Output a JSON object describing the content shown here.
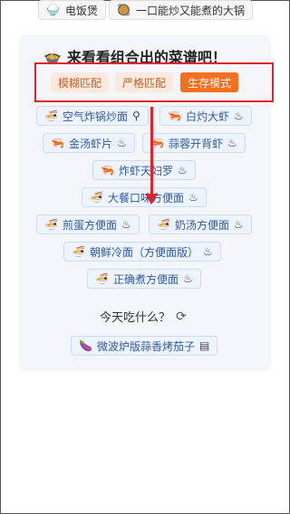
{
  "top_chips": [
    {
      "icon": "🍚",
      "label": "电饭煲"
    },
    {
      "icon": "🥘",
      "label": "一口能炒又能煮的大锅"
    }
  ],
  "header": {
    "icon": "🍲",
    "title": "来看看组合出的菜谱吧！"
  },
  "modes": {
    "fuzzy": "模糊匹配",
    "strict": "严格匹配",
    "survival": "生存模式"
  },
  "recipes": [
    {
      "icon": "🍜",
      "label": "空气炸锅炒面",
      "trail": "⚲"
    },
    {
      "icon": "🦐",
      "label": "白灼大虾",
      "trail": "♨"
    },
    {
      "icon": "🦐",
      "label": "金汤虾片",
      "trail": "♨"
    },
    {
      "icon": "🦐",
      "label": "蒜蓉开背虾",
      "trail": "♨"
    },
    {
      "icon": "🦐",
      "label": "炸虾天妇罗",
      "trail": "♨"
    },
    {
      "icon": "🍜",
      "label": "大餐口味方便面",
      "trail": "♨"
    },
    {
      "icon": "🍜",
      "label": "煎蛋方便面",
      "trail": "♨"
    },
    {
      "icon": "🍜",
      "label": "奶汤方便面",
      "trail": "♨"
    },
    {
      "icon": "🍜",
      "label": "朝鲜冷面（方便面版）",
      "trail": "♨"
    },
    {
      "icon": "🍜",
      "label": "正确煮方便面",
      "trail": "♨"
    }
  ],
  "question": {
    "text": "今天吃什么？",
    "icon": "⟳"
  },
  "suggestion": {
    "icon": "🍆",
    "label": "微波炉版蒜香烤茄子",
    "trail": "▤"
  },
  "colors": {
    "accent": "#f5701e",
    "highlight": "#e0222e"
  }
}
